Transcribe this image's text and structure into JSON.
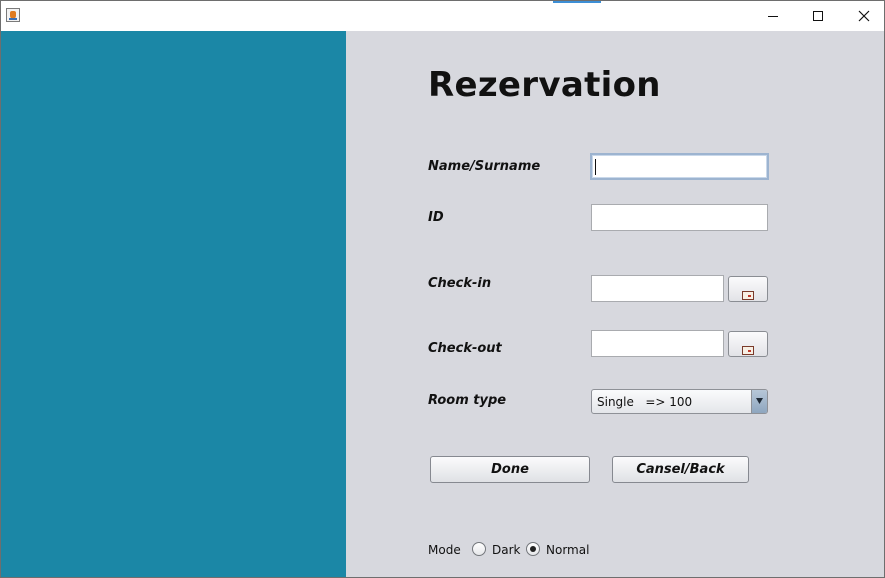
{
  "window": {
    "app_icon": "java-cup-icon",
    "controls": [
      "minimize-icon",
      "maximize-icon",
      "close-icon"
    ]
  },
  "colors": {
    "left_panel": "#1b87a6",
    "right_panel": "#d7d8de"
  },
  "form": {
    "title": "Rezervation",
    "name_label": "Name/Surname",
    "name_value": "",
    "id_label": "ID",
    "id_value": "",
    "checkin_label": "Check-in",
    "checkin_value": "",
    "checkin_button_icon": "calendar-icon",
    "checkout_label": "Check-out",
    "checkout_value": "",
    "checkout_button_icon": "calendar-icon",
    "room_label": "Room type",
    "room_selected": "Single   => 100",
    "done_label": "Done",
    "cancel_label": "Cansel/Back"
  },
  "mode": {
    "label": "Mode",
    "options": [
      {
        "label": "Dark",
        "selected": false
      },
      {
        "label": "Normal",
        "selected": true
      }
    ]
  }
}
